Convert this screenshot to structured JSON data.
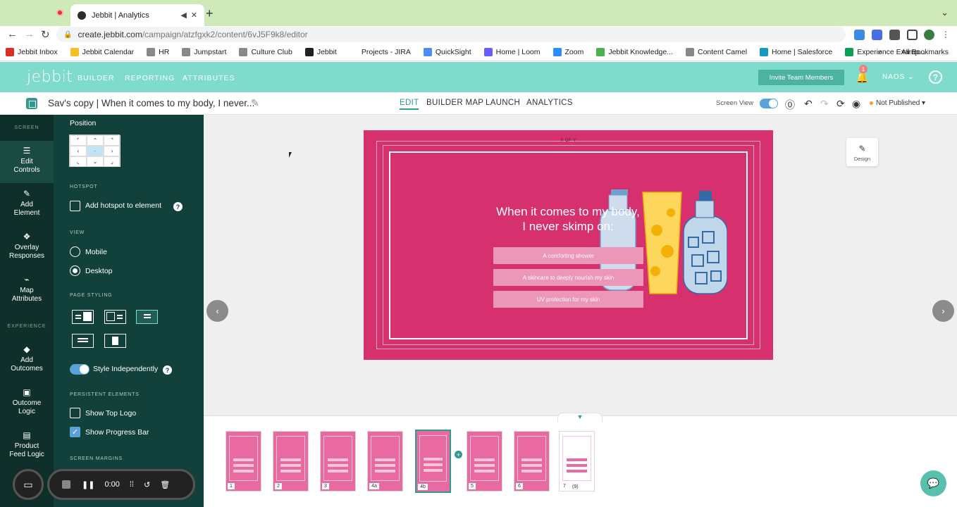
{
  "browser": {
    "tab_title": "Jebbit | Analytics",
    "url_host": "create.jebbit.com",
    "url_path": "/campaign/atzfgxk2/content/6vJ5F9k8/editor",
    "bookmarks": [
      {
        "label": "Jebbit Inbox",
        "color": "#d93025"
      },
      {
        "label": "Jebbit Calendar",
        "color": "#f6bf26"
      },
      {
        "label": "HR",
        "color": "#888888"
      },
      {
        "label": "Jumpstart",
        "color": "#888888"
      },
      {
        "label": "Culture Club",
        "color": "#888888"
      },
      {
        "label": "Jebbit",
        "color": "#222222"
      },
      {
        "label": "Projects - JIRA",
        "color": "#ffffff"
      },
      {
        "label": "QuickSight",
        "color": "#4c8df6"
      },
      {
        "label": "Home | Loom",
        "color": "#6b5cff"
      },
      {
        "label": "Zoom",
        "color": "#2d8cff"
      },
      {
        "label": "Jebbit Knowledge...",
        "color": "#4caf50"
      },
      {
        "label": "Content Camel",
        "color": "#888888"
      },
      {
        "label": "Home | Salesforce",
        "color": "#1798c1"
      },
      {
        "label": "Experience Examp...",
        "color": "#0f9d58"
      }
    ],
    "all_bookmarks": "All Bookmarks"
  },
  "appbar": {
    "logo": "jebbit",
    "nav": [
      "BUILDER",
      "REPORTING",
      "ATTRIBUTES"
    ],
    "invite_label": "Invite Team Members",
    "notif_count": "1",
    "user": "NAOS",
    "help": "?"
  },
  "subbar": {
    "campaign_title": "Sav's copy | When it comes to my body, I never...",
    "modes": [
      "EDIT",
      "BUILDER MAP",
      "LAUNCH",
      "ANALYTICS"
    ],
    "active_mode": "EDIT",
    "screen_view": "Screen View",
    "publish_status": "Not Published"
  },
  "rail": {
    "screen_section": "SCREEN",
    "experience_section": "EXPERIENCE",
    "items": [
      {
        "l1": "Edit",
        "l2": "Controls",
        "icon": "sliders-icon"
      },
      {
        "l1": "Add",
        "l2": "Element",
        "icon": "pencil-icon"
      },
      {
        "l1": "Overlay",
        "l2": "Responses",
        "icon": "overlay-icon"
      },
      {
        "l1": "Map",
        "l2": "Attributes",
        "icon": "map-icon"
      },
      {
        "l1": "Add",
        "l2": "Outcomes",
        "icon": "diamond-icon"
      },
      {
        "l1": "Outcome",
        "l2": "Logic",
        "icon": "logic-icon"
      },
      {
        "l1": "Product",
        "l2": "Feed Logic",
        "icon": "feed-icon"
      }
    ]
  },
  "panel": {
    "position_label": "Position",
    "hotspot_section": "HOTSPOT",
    "hotspot_label": "Add hotspot to element",
    "view_section": "VIEW",
    "mobile_label": "Mobile",
    "desktop_label": "Desktop",
    "page_styling_section": "PAGE STYLING",
    "style_independently": "Style Independently",
    "persistent_section": "PERSISTENT ELEMENTS",
    "show_top_logo": "Show Top Logo",
    "show_progress_bar": "Show Progress Bar",
    "screen_margins_section": "SCREEN MARGINS"
  },
  "recorder": {
    "time": "0:00"
  },
  "slide": {
    "counter": "X OF Y",
    "question_line1": "When it comes to my body,",
    "question_line2": "I never skimp on:",
    "answers": [
      "A comforting shower",
      "A skincare to deeply nourish my skin",
      "UV protection for my skin"
    ],
    "bg_color": "#d6306f"
  },
  "design_button": "Design",
  "filmstrip": {
    "thumbs": [
      "1",
      "2",
      "3",
      "4a",
      "4b",
      "5",
      "6",
      "7"
    ],
    "selected": "4b",
    "last_count": "(9)"
  }
}
